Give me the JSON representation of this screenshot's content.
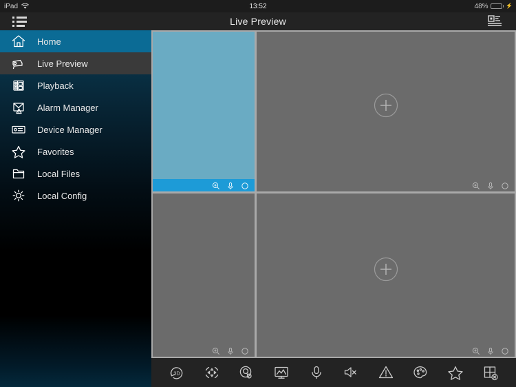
{
  "status_bar": {
    "carrier": "iPad",
    "wifi_icon": "wifi-icon",
    "time": "13:52",
    "battery_percent": "48%",
    "battery_level": 48,
    "charging_icon": "lightning-bolt-icon",
    "battery_color": "#36c24a"
  },
  "nav_bar": {
    "menu_icon": "list-menu-icon",
    "title": "Live Preview",
    "device_list_icon": "device-list-icon"
  },
  "sidebar": {
    "accent_color": "#0b6b95",
    "selected_color": "#3a3a3a",
    "items": [
      {
        "label": "Home",
        "icon": "home-icon",
        "state": "highlighted"
      },
      {
        "label": "Live Preview",
        "icon": "camera-icon",
        "state": "selected"
      },
      {
        "label": "Playback",
        "icon": "film-strip-icon",
        "state": "normal"
      },
      {
        "label": "Alarm Manager",
        "icon": "alarm-envelope-icon",
        "state": "normal"
      },
      {
        "label": "Device Manager",
        "icon": "device-box-icon",
        "state": "normal"
      },
      {
        "label": "Favorites",
        "icon": "star-icon",
        "state": "normal"
      },
      {
        "label": "Local Files",
        "icon": "folder-icon",
        "state": "normal"
      },
      {
        "label": "Local Config",
        "icon": "gear-icon",
        "state": "normal"
      }
    ]
  },
  "video_grid": {
    "layout": "4-pane",
    "active_pane_color": "#6aabc3",
    "active_bar_color": "#1d9bd7",
    "empty_pane_color": "#6b6b6b",
    "panes": [
      {
        "index": 1,
        "state": "active",
        "has_add_button": false,
        "controls": [
          "zoom-in-icon",
          "microphone-icon",
          "record-icon"
        ]
      },
      {
        "index": 2,
        "state": "empty",
        "has_add_button": true,
        "add_label": "+",
        "controls": [
          "zoom-in-icon",
          "microphone-icon",
          "record-icon"
        ]
      },
      {
        "index": 3,
        "state": "empty",
        "has_add_button": false,
        "controls": [
          "zoom-in-icon",
          "microphone-icon",
          "record-icon"
        ]
      },
      {
        "index": 4,
        "state": "empty",
        "has_add_button": true,
        "add_label": "+",
        "controls": [
          "zoom-in-icon",
          "microphone-icon",
          "record-icon"
        ]
      }
    ]
  },
  "toolbar": {
    "buttons": [
      {
        "name": "3d-positioning-icon",
        "label": "3D Positioning"
      },
      {
        "name": "ptz-control-icon",
        "label": "PTZ Control"
      },
      {
        "name": "fisheye-icon",
        "label": "Fisheye"
      },
      {
        "name": "snapshot-icon",
        "label": "Snapshot"
      },
      {
        "name": "microphone-icon",
        "label": "Talk"
      },
      {
        "name": "speaker-mute-icon",
        "label": "Audio"
      },
      {
        "name": "alarm-warning-icon",
        "label": "Alarm Output"
      },
      {
        "name": "color-palette-icon",
        "label": "Image Adjust"
      },
      {
        "name": "star-favorite-icon",
        "label": "Favorite"
      },
      {
        "name": "close-all-grid-icon",
        "label": "Close All"
      }
    ]
  }
}
